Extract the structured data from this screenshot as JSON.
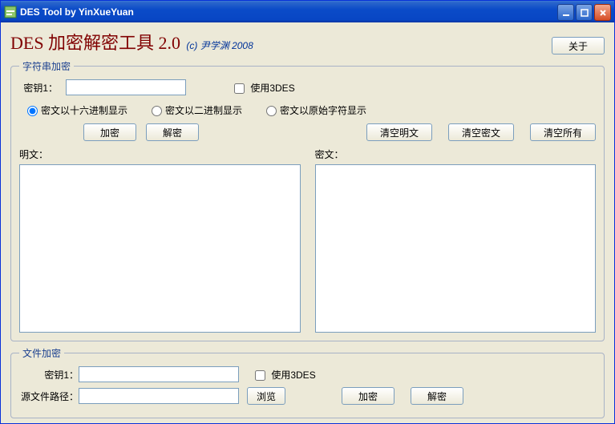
{
  "window_title": "DES Tool by YinXueYuan",
  "app_heading": "DES 加密解密工具 2.0",
  "copyright": "(c) 尹学渊 2008",
  "about_button": "关于",
  "string_section": {
    "legend": "字符串加密",
    "key_label": "密钥1：",
    "key_value": "",
    "use_3des_label": "使用3DES",
    "use_3des_checked": false,
    "radio_hex": "密文以十六进制显示",
    "radio_bin": "密文以二进制显示",
    "radio_raw": "密文以原始字符显示",
    "radio_selected": "hex",
    "encrypt_button": "加密",
    "decrypt_button": "解密",
    "clear_plain_button": "清空明文",
    "clear_cipher_button": "清空密文",
    "clear_all_button": "清空所有",
    "plain_label": "明文：",
    "cipher_label": "密文：",
    "plain_value": "",
    "cipher_value": ""
  },
  "file_section": {
    "legend": "文件加密",
    "key_label": "密钥1：",
    "key_value": "",
    "use_3des_label": "使用3DES",
    "use_3des_checked": false,
    "src_label": "源文件路径：",
    "src_value": "",
    "browse_button": "浏览",
    "encrypt_button": "加密",
    "decrypt_button": "解密"
  }
}
